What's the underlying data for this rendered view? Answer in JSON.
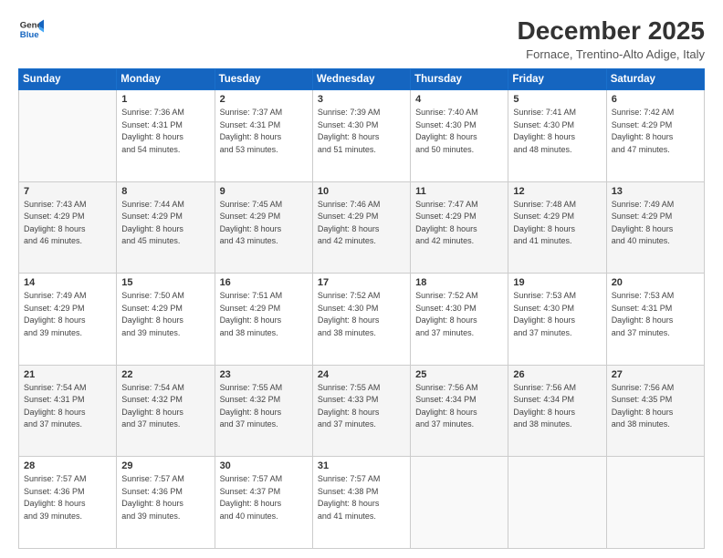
{
  "logo": {
    "line1": "General",
    "line2": "Blue"
  },
  "title": "December 2025",
  "location": "Fornace, Trentino-Alto Adige, Italy",
  "days_header": [
    "Sunday",
    "Monday",
    "Tuesday",
    "Wednesday",
    "Thursday",
    "Friday",
    "Saturday"
  ],
  "weeks": [
    [
      {
        "day": "",
        "info": ""
      },
      {
        "day": "1",
        "info": "Sunrise: 7:36 AM\nSunset: 4:31 PM\nDaylight: 8 hours\nand 54 minutes."
      },
      {
        "day": "2",
        "info": "Sunrise: 7:37 AM\nSunset: 4:31 PM\nDaylight: 8 hours\nand 53 minutes."
      },
      {
        "day": "3",
        "info": "Sunrise: 7:39 AM\nSunset: 4:30 PM\nDaylight: 8 hours\nand 51 minutes."
      },
      {
        "day": "4",
        "info": "Sunrise: 7:40 AM\nSunset: 4:30 PM\nDaylight: 8 hours\nand 50 minutes."
      },
      {
        "day": "5",
        "info": "Sunrise: 7:41 AM\nSunset: 4:30 PM\nDaylight: 8 hours\nand 48 minutes."
      },
      {
        "day": "6",
        "info": "Sunrise: 7:42 AM\nSunset: 4:29 PM\nDaylight: 8 hours\nand 47 minutes."
      }
    ],
    [
      {
        "day": "7",
        "info": "Sunrise: 7:43 AM\nSunset: 4:29 PM\nDaylight: 8 hours\nand 46 minutes."
      },
      {
        "day": "8",
        "info": "Sunrise: 7:44 AM\nSunset: 4:29 PM\nDaylight: 8 hours\nand 45 minutes."
      },
      {
        "day": "9",
        "info": "Sunrise: 7:45 AM\nSunset: 4:29 PM\nDaylight: 8 hours\nand 43 minutes."
      },
      {
        "day": "10",
        "info": "Sunrise: 7:46 AM\nSunset: 4:29 PM\nDaylight: 8 hours\nand 42 minutes."
      },
      {
        "day": "11",
        "info": "Sunrise: 7:47 AM\nSunset: 4:29 PM\nDaylight: 8 hours\nand 42 minutes."
      },
      {
        "day": "12",
        "info": "Sunrise: 7:48 AM\nSunset: 4:29 PM\nDaylight: 8 hours\nand 41 minutes."
      },
      {
        "day": "13",
        "info": "Sunrise: 7:49 AM\nSunset: 4:29 PM\nDaylight: 8 hours\nand 40 minutes."
      }
    ],
    [
      {
        "day": "14",
        "info": "Sunrise: 7:49 AM\nSunset: 4:29 PM\nDaylight: 8 hours\nand 39 minutes."
      },
      {
        "day": "15",
        "info": "Sunrise: 7:50 AM\nSunset: 4:29 PM\nDaylight: 8 hours\nand 39 minutes."
      },
      {
        "day": "16",
        "info": "Sunrise: 7:51 AM\nSunset: 4:29 PM\nDaylight: 8 hours\nand 38 minutes."
      },
      {
        "day": "17",
        "info": "Sunrise: 7:52 AM\nSunset: 4:30 PM\nDaylight: 8 hours\nand 38 minutes."
      },
      {
        "day": "18",
        "info": "Sunrise: 7:52 AM\nSunset: 4:30 PM\nDaylight: 8 hours\nand 37 minutes."
      },
      {
        "day": "19",
        "info": "Sunrise: 7:53 AM\nSunset: 4:30 PM\nDaylight: 8 hours\nand 37 minutes."
      },
      {
        "day": "20",
        "info": "Sunrise: 7:53 AM\nSunset: 4:31 PM\nDaylight: 8 hours\nand 37 minutes."
      }
    ],
    [
      {
        "day": "21",
        "info": "Sunrise: 7:54 AM\nSunset: 4:31 PM\nDaylight: 8 hours\nand 37 minutes."
      },
      {
        "day": "22",
        "info": "Sunrise: 7:54 AM\nSunset: 4:32 PM\nDaylight: 8 hours\nand 37 minutes."
      },
      {
        "day": "23",
        "info": "Sunrise: 7:55 AM\nSunset: 4:32 PM\nDaylight: 8 hours\nand 37 minutes."
      },
      {
        "day": "24",
        "info": "Sunrise: 7:55 AM\nSunset: 4:33 PM\nDaylight: 8 hours\nand 37 minutes."
      },
      {
        "day": "25",
        "info": "Sunrise: 7:56 AM\nSunset: 4:34 PM\nDaylight: 8 hours\nand 37 minutes."
      },
      {
        "day": "26",
        "info": "Sunrise: 7:56 AM\nSunset: 4:34 PM\nDaylight: 8 hours\nand 38 minutes."
      },
      {
        "day": "27",
        "info": "Sunrise: 7:56 AM\nSunset: 4:35 PM\nDaylight: 8 hours\nand 38 minutes."
      }
    ],
    [
      {
        "day": "28",
        "info": "Sunrise: 7:57 AM\nSunset: 4:36 PM\nDaylight: 8 hours\nand 39 minutes."
      },
      {
        "day": "29",
        "info": "Sunrise: 7:57 AM\nSunset: 4:36 PM\nDaylight: 8 hours\nand 39 minutes."
      },
      {
        "day": "30",
        "info": "Sunrise: 7:57 AM\nSunset: 4:37 PM\nDaylight: 8 hours\nand 40 minutes."
      },
      {
        "day": "31",
        "info": "Sunrise: 7:57 AM\nSunset: 4:38 PM\nDaylight: 8 hours\nand 41 minutes."
      },
      {
        "day": "",
        "info": ""
      },
      {
        "day": "",
        "info": ""
      },
      {
        "day": "",
        "info": ""
      }
    ]
  ]
}
